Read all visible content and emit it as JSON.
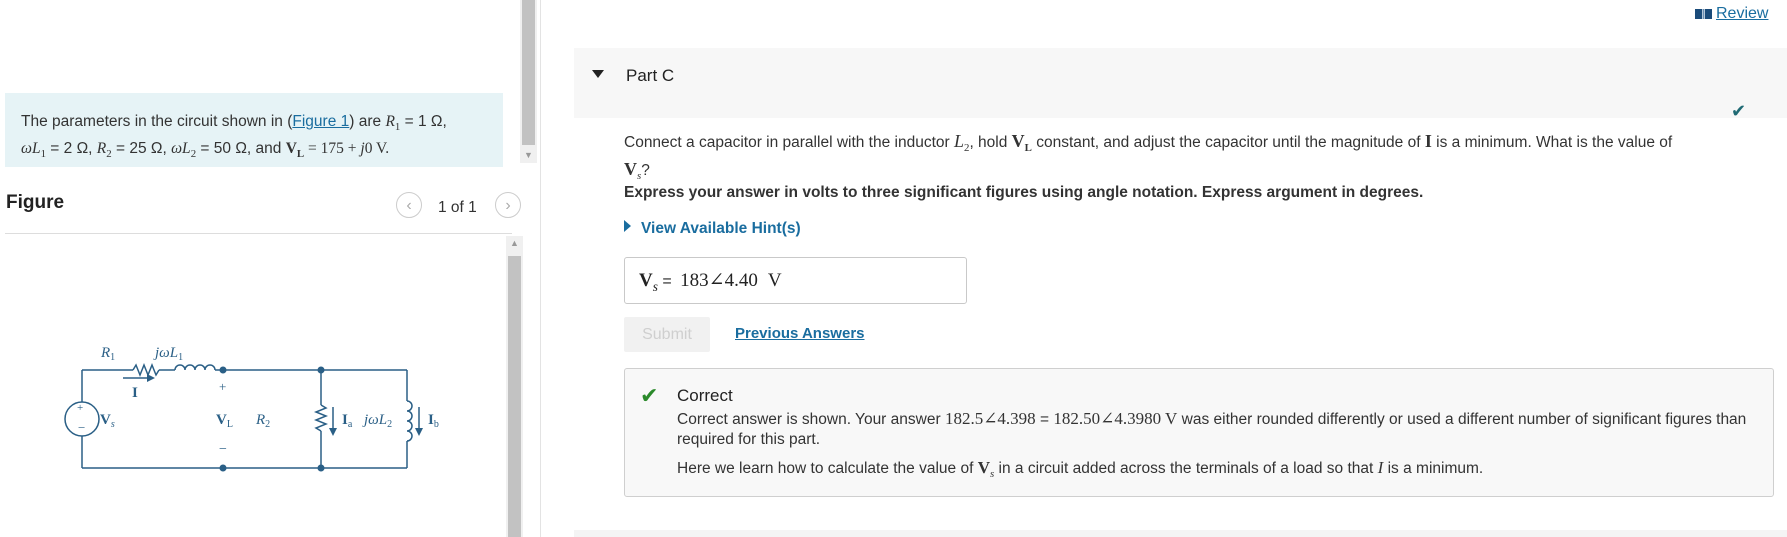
{
  "review": {
    "label": "Review"
  },
  "problem": {
    "prefix": "The parameters in the circuit shown in (",
    "figure_link": "Figure 1",
    "suffix": ") are",
    "params": {
      "r1": "R",
      "r1_sub": "1",
      "r1_val": " = 1 Ω,",
      "wl1": "ωL",
      "wl1_sub": "1",
      "wl1_val": " = 2 Ω, ",
      "r2": "R",
      "r2_sub": "2",
      "r2_val": " = 25 Ω, ",
      "wl2": "ωL",
      "wl2_sub": "2",
      "wl2_val": " = 50 Ω, and ",
      "vl": "V",
      "vl_sub": "L",
      "vl_val": " = 175 + ",
      "j0": "j",
      "j0_tail": "0 V."
    }
  },
  "figure": {
    "title": "Figure",
    "counter": "1 of 1",
    "labels": {
      "r1": "R",
      "r1_sub": "1",
      "jwl1": "jωL",
      "jwl1_sub": "1",
      "i": "I",
      "vs": "V",
      "vs_sub": "s",
      "plus": "+",
      "minus": "−",
      "vl": "V",
      "vl_sub": "L",
      "r2": "R",
      "r2_sub": "2",
      "ia": "I",
      "ia_sub": "a",
      "jwl2": "jωL",
      "jwl2_sub": "2",
      "ib": "I",
      "ib_sub": "b"
    }
  },
  "part": {
    "title": "Part C"
  },
  "question": {
    "t1": "Connect a capacitor in parallel with the inductor ",
    "l2": "L",
    "l2_sub": "2",
    "t2": ", hold ",
    "vl": "V",
    "vl_sub": "L",
    "t3": " constant, and adjust the capacitor until the magnitude of ",
    "i": "I",
    "t4": " is a minimum. What is the value of ",
    "vs": "V",
    "vs_sub": "s",
    "t5": "?"
  },
  "instructions": "Express your answer in volts to three significant figures using angle notation. Express argument in degrees.",
  "hints": {
    "label": "View Available Hint(s)"
  },
  "answer": {
    "var": "V",
    "var_sub": "s",
    "eq": " = ",
    "value": "183∠4.40",
    "unit": "V"
  },
  "submit": {
    "label": "Submit"
  },
  "previous_answers": {
    "label": "Previous Answers"
  },
  "feedback": {
    "title": "Correct",
    "t1": "Correct answer is shown. Your answer ",
    "a1": "182.5∠4.398",
    "t2": " = ",
    "a2": "182.50∠4.3980",
    "a2_unit": " V",
    "t3": " was either rounded differently or used a different number of significant figures than required for this part.",
    "n1": "Here we learn how to calculate the value of ",
    "n_vs": "V",
    "n_vs_sub": "s",
    "n2": " in a circuit added across the terminals of a load so that ",
    "n_i": "I",
    "n3": " is a minimum."
  },
  "colors": {
    "link": "#1a6d9f",
    "correct": "#2b8a2b",
    "problem_bg": "#e6f3f6",
    "circuit": "#2a5f86"
  }
}
